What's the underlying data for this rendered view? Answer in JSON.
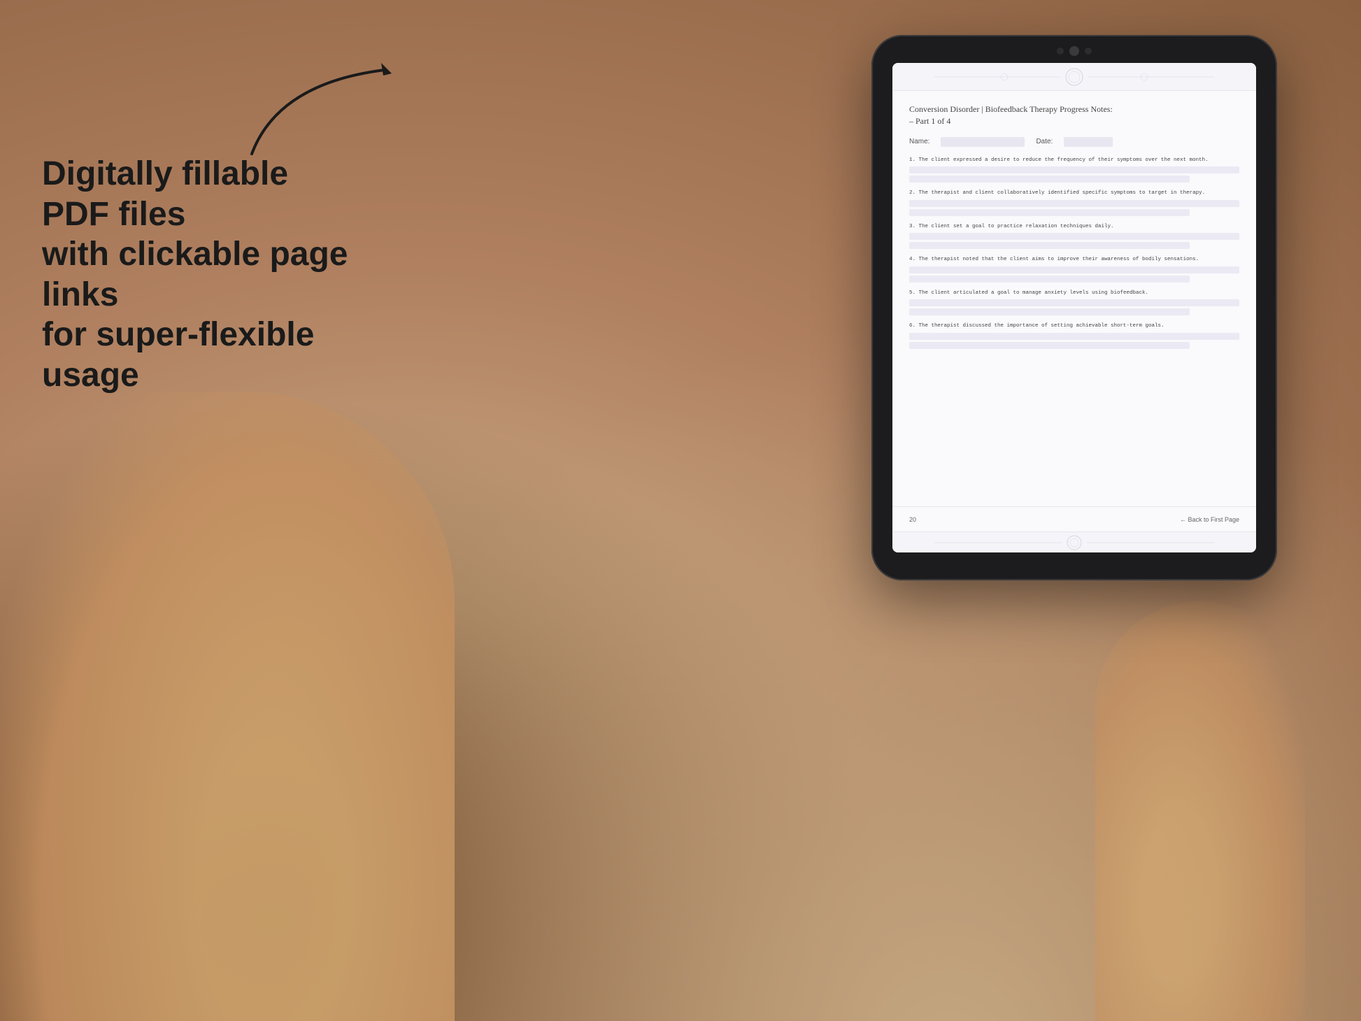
{
  "background": {
    "color": "#b8957a"
  },
  "tagline": {
    "line1": "Digitally fillable PDF files",
    "line2": "with clickable page links",
    "line3": "for super-flexible usage"
  },
  "tablet": {
    "screen": {
      "document": {
        "title_line1": "Conversion Disorder | Biofeedback Therapy Progress Notes:",
        "title_line2": "– Part 1 of 4",
        "name_label": "Name:",
        "date_label": "Date:",
        "items": [
          {
            "number": "1.",
            "text": "The client expressed a desire to reduce the frequency of their symptoms over the next\nmonth."
          },
          {
            "number": "2.",
            "text": "The therapist and client collaboratively identified specific symptoms to target in\ntherapy."
          },
          {
            "number": "3.",
            "text": "The client set a goal to practice relaxation techniques daily."
          },
          {
            "number": "4.",
            "text": "The therapist noted that the client aims to improve their awareness of bodily sensations."
          },
          {
            "number": "5.",
            "text": "The client articulated a goal to manage anxiety levels using biofeedback."
          },
          {
            "number": "6.",
            "text": "The therapist discussed the importance of setting achievable short-term goals."
          }
        ],
        "page_number": "20",
        "back_link": "← Back to First Page"
      }
    }
  }
}
